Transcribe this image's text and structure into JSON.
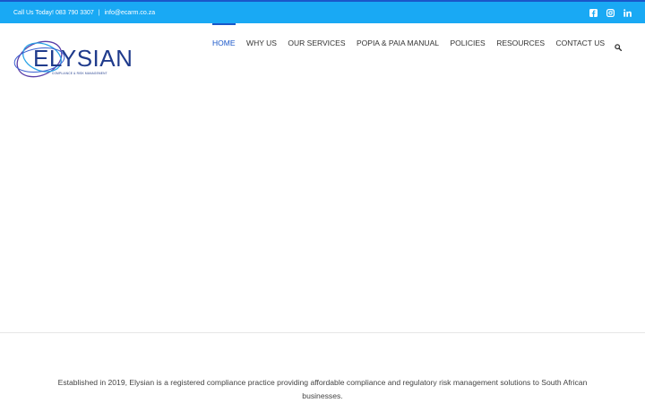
{
  "topbar": {
    "phone_text": "Call Us Today! 083 790 3307",
    "separator": "|",
    "email_text": "info@ecarm.co.za",
    "social": [
      "facebook-icon",
      "instagram-icon",
      "linkedin-icon"
    ],
    "background": "#19a9f4"
  },
  "logo": {
    "name": "ELYSIAN",
    "tagline": "COMPLIANCE & RISK MANAGEMENT"
  },
  "nav": {
    "items": [
      {
        "label": "HOME",
        "active": true
      },
      {
        "label": "WHY US"
      },
      {
        "label": "OUR SERVICES"
      },
      {
        "label": "POPIA & PAIA MANUAL"
      },
      {
        "label": "POLICIES"
      },
      {
        "label": "RESOURCES"
      },
      {
        "label": "CONTACT US"
      }
    ],
    "search_icon": "search-icon",
    "accent": "#1a57c9"
  },
  "intro": {
    "text": "Established in 2019, Elysian is a registered compliance practice providing affordable compliance and regulatory risk management solutions to South African businesses."
  }
}
